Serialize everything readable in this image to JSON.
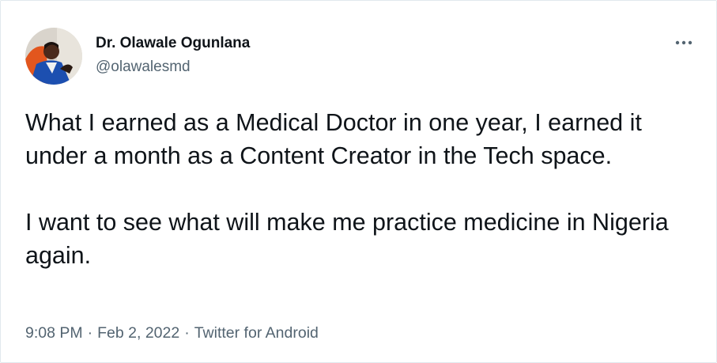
{
  "author": {
    "display_name": "Dr. Olawale Ogunlana",
    "handle": "@olawalesmd",
    "avatar_icon": "profile-photo"
  },
  "more_icon": "more-dots-icon",
  "tweet": {
    "paragraphs": [
      "What I earned as a Medical Doctor in one year, I earned it under a month as a Content Creator in the Tech space.",
      "I want to see what will make me practice medicine in Nigeria again."
    ]
  },
  "meta": {
    "time": "9:08 PM",
    "separator": "·",
    "date": "Feb 2, 2022",
    "source": "Twitter for Android"
  },
  "colors": {
    "text": "#0f1419",
    "secondary": "#536471",
    "border": "#e1e8ed"
  }
}
